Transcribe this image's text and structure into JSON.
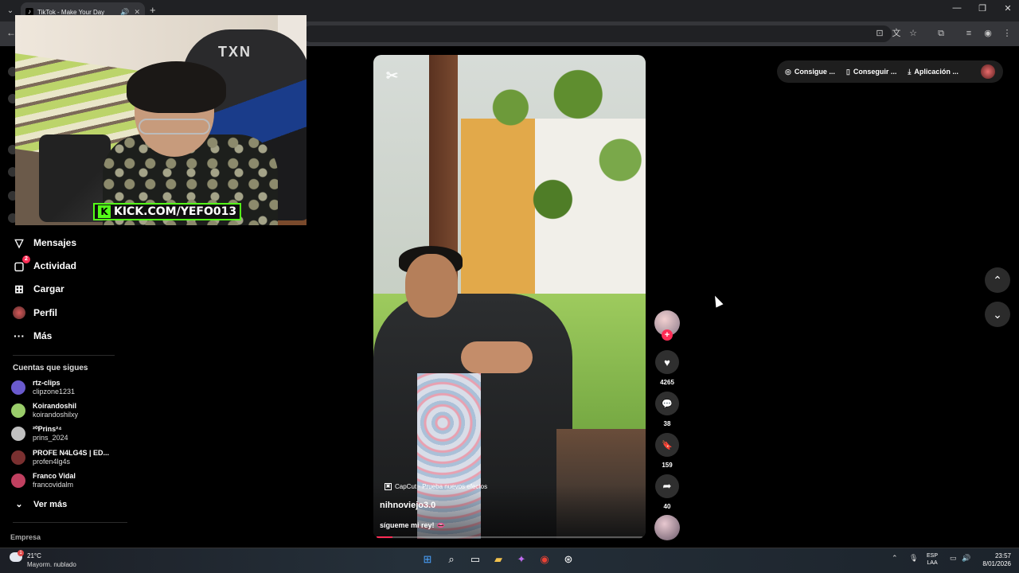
{
  "browser": {
    "tab_title": "TikTok - Make Your Day",
    "tab_favicon": "tiktok-icon",
    "tab_mute_icon": "🔊",
    "tab_close_icon": "✕",
    "new_tab_icon": "+",
    "window_minimize": "—",
    "window_restore": "❐",
    "window_close": "✕"
  },
  "stream_overlay": {
    "kick_logo": "K",
    "kick_url": "KICK.COM/YEFO013"
  },
  "sidebar": {
    "nav": [
      {
        "label": "Mensajes",
        "icon": "send-icon",
        "glyph": "▽"
      },
      {
        "label": "Actividad",
        "icon": "activity-icon",
        "glyph": "▢",
        "badge": "2"
      },
      {
        "label": "Cargar",
        "icon": "upload-icon",
        "glyph": "⊞"
      },
      {
        "label": "Perfil",
        "icon": "profile-avatar-icon",
        "glyph": ""
      },
      {
        "label": "Más",
        "icon": "more-icon",
        "glyph": "···"
      }
    ],
    "following_title": "Cuentas que sigues",
    "accounts": [
      {
        "name": "rtz-clips",
        "username": "clipzone1231",
        "color": "#6a5acd"
      },
      {
        "name": "Koirandoshil",
        "username": "koirandoshilxy",
        "color": "#9acd6a"
      },
      {
        "name": "²⁰Prins²⁴",
        "username": "prins_2024",
        "color": "#c0c0c0"
      },
      {
        "name": "PROFE N4LG4S | ED...",
        "username": "profen4lg4s",
        "color": "#7a3030"
      },
      {
        "name": "Franco Vidal",
        "username": "francovidalm",
        "color": "#c04060"
      }
    ],
    "see_more": "Ver más",
    "see_more_icon": "⌄",
    "footer_label": "Empresa"
  },
  "top_actions": [
    {
      "label": "Consigue ...",
      "icon": "coin-icon",
      "glyph": "◎"
    },
    {
      "label": "Conseguir ...",
      "icon": "phone-icon",
      "glyph": "▯"
    },
    {
      "label": "Aplicación ...",
      "icon": "download-icon",
      "glyph": "⤓"
    }
  ],
  "video": {
    "watermark": "✂",
    "effect_tag": "CapCut · Prueba nuevos efectos",
    "author": "nihnoviejo3.0",
    "caption": "sígueme mi rey! 👄",
    "progress": 0.06
  },
  "actions": {
    "follow_icon": "+",
    "like_icon": "♥",
    "likes": "4265",
    "comment_icon": "💬",
    "comments": "38",
    "save_icon": "🔖",
    "saves": "159",
    "share_icon": "➦",
    "shares": "40"
  },
  "feed_nav": {
    "up": "⌃",
    "down": "⌄"
  },
  "taskbar": {
    "temperature": "21°C",
    "weather": "Mayorm. nublado",
    "weather_badge": "1",
    "lang_top": "ESP",
    "lang_bottom": "LAA",
    "time": "23:57",
    "date": "8/01/2026"
  },
  "colors": {
    "accent": "#fe2c55",
    "kick_green": "#53fc18"
  }
}
